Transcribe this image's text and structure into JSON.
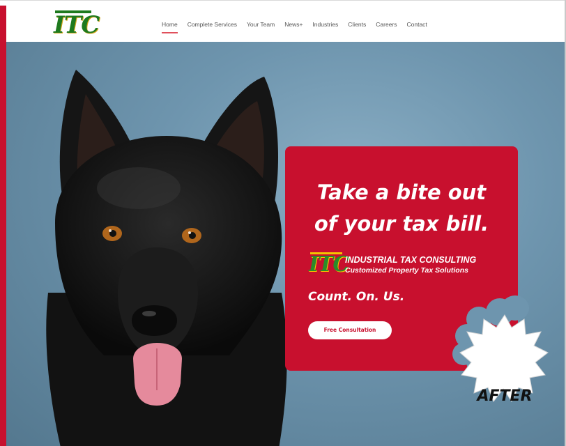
{
  "header": {
    "logo_text": "ITC",
    "nav": [
      "Home",
      "Complete Services",
      "Your Team",
      "News+",
      "Industries",
      "Clients",
      "Careers",
      "Contact"
    ],
    "active_nav": "Home"
  },
  "hero": {
    "headline_line1": "Take a bite out",
    "headline_line2": "of your tax bill.",
    "brand_logo_text": "ITC",
    "brand_name": "INDUSTRIAL TAX CONSULTING",
    "brand_tagline": "Customized Property Tax Solutions",
    "slogan": "Count. On. Us.",
    "cta_label": "Free Consultation",
    "badge_label": "AFTER",
    "image_subject": "black-german-shepherd-dog"
  },
  "colors": {
    "brand_red": "#c8102e",
    "logo_green": "#1e7a1e",
    "logo_gold": "#d4a419",
    "hero_blue": "#6e95ae",
    "nav_underline": "#e0505c"
  }
}
